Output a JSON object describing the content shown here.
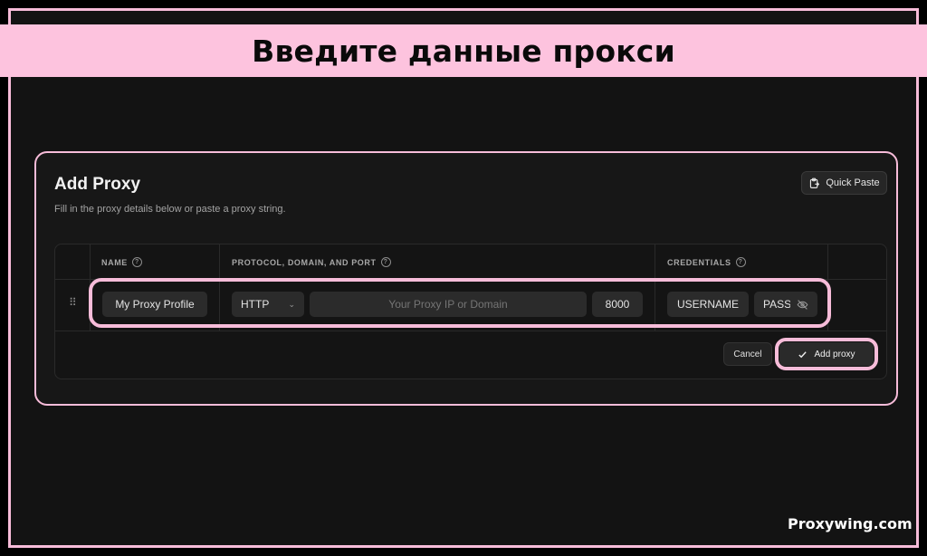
{
  "banner": {
    "title": "Введите данные прокси"
  },
  "dialog": {
    "title": "Add Proxy",
    "subtitle": "Fill in the proxy details below or paste a proxy string.",
    "quick_paste_label": "Quick Paste"
  },
  "table": {
    "headers": {
      "name": "NAME",
      "protocol": "PROTOCOL, DOMAIN, AND PORT",
      "credentials": "CREDENTIALS"
    },
    "help_glyph": "?",
    "drag_glyph": "⠿",
    "row": {
      "name": "My Proxy Profile",
      "protocol": "HTTP",
      "host_placeholder": "Your Proxy IP or Domain",
      "port": "8000",
      "username": "USERNAME",
      "password": "PASSWORD"
    }
  },
  "actions": {
    "cancel_label": "Cancel",
    "add_label": "Add proxy"
  },
  "watermark": "Proxywing.com",
  "colors": {
    "accent_pink": "#f7bcd9",
    "background": "#131313",
    "field": "#2b2b2b"
  }
}
